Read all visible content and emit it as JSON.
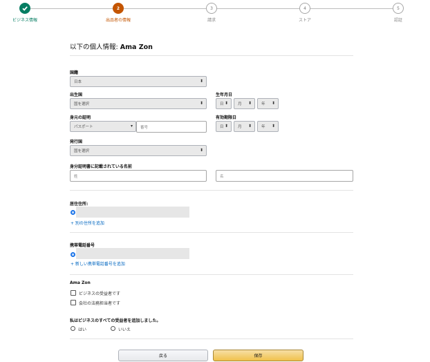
{
  "stepper": {
    "steps": [
      {
        "number": "",
        "label": "ビジネス情報",
        "state": "done"
      },
      {
        "number": "2",
        "label": "出品者の情報",
        "state": "active"
      },
      {
        "number": "3",
        "label": "請求",
        "state": "todo"
      },
      {
        "number": "4",
        "label": "ストア",
        "state": "todo"
      },
      {
        "number": "5",
        "label": "認証",
        "state": "todo"
      }
    ]
  },
  "title": {
    "prefix": "以下の個人情報: ",
    "name": "Ama Zon"
  },
  "nationality": {
    "label": "国籍",
    "value": "日本"
  },
  "birth_country": {
    "label": "出生国",
    "placeholder": "国を選択"
  },
  "dob": {
    "label": "生年月日",
    "day": "日",
    "month": "月",
    "year": "年"
  },
  "id_proof": {
    "label": "身元の証明",
    "type": "パスポート",
    "number_placeholder": "番号"
  },
  "expiry": {
    "label": "有効期限日",
    "day": "日",
    "month": "月",
    "year": "年"
  },
  "issuing_country": {
    "label": "発行国",
    "placeholder": "国を選択"
  },
  "id_name": {
    "label": "身分証明書に記載されている名前",
    "last_placeholder": "姓",
    "first_placeholder": "名"
  },
  "address": {
    "label": "居住住所:",
    "add_link": "+ 別の住所を追加"
  },
  "phone": {
    "label": "携帯電話番号",
    "add_link": "+ 新しい携帯電話番号を追加"
  },
  "person": {
    "name": "Ama Zon",
    "beneficial_owner": "ビジネスの受益者です",
    "legal_rep": "会社の法務担当者です"
  },
  "all_owners": {
    "question": "私はビジネスのすべての受益者を追加しました。",
    "yes": "はい",
    "no": "いいえ"
  },
  "buttons": {
    "back": "戻る",
    "save": "保存"
  }
}
